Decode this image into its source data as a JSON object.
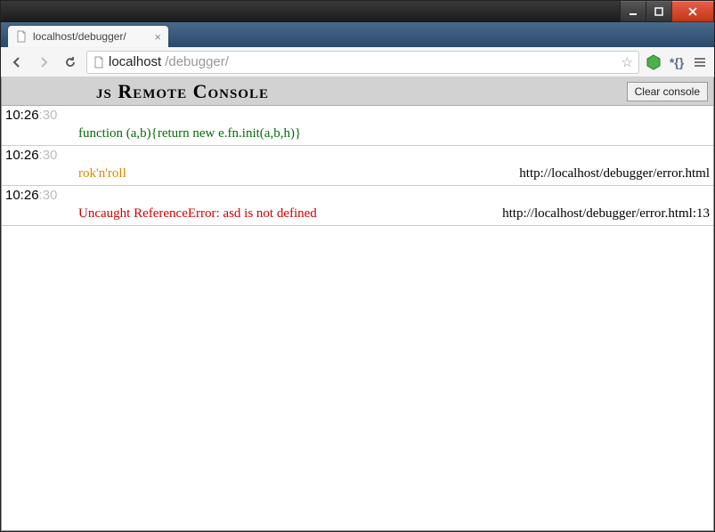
{
  "browser": {
    "tab_title": "localhost/debugger/",
    "url_host": "localhost",
    "url_path": "/debugger/",
    "menu_tooltip": "Menu"
  },
  "app": {
    "title": "js Remote Console",
    "clear_button": "Clear console"
  },
  "entries": [
    {
      "ts_main": "10:26",
      "ts_sec": ":30",
      "level": "log",
      "message": "function (a,b){return new e.fn.init(a,b,h)}",
      "source": ""
    },
    {
      "ts_main": "10:26",
      "ts_sec": ":30",
      "level": "warn",
      "message": "rok'n'roll",
      "source": "http://localhost/debugger/error.html"
    },
    {
      "ts_main": "10:26",
      "ts_sec": ":30",
      "level": "error",
      "message": "Uncaught ReferenceError: asd is not defined",
      "source": "http://localhost/debugger/error.html:13"
    }
  ]
}
